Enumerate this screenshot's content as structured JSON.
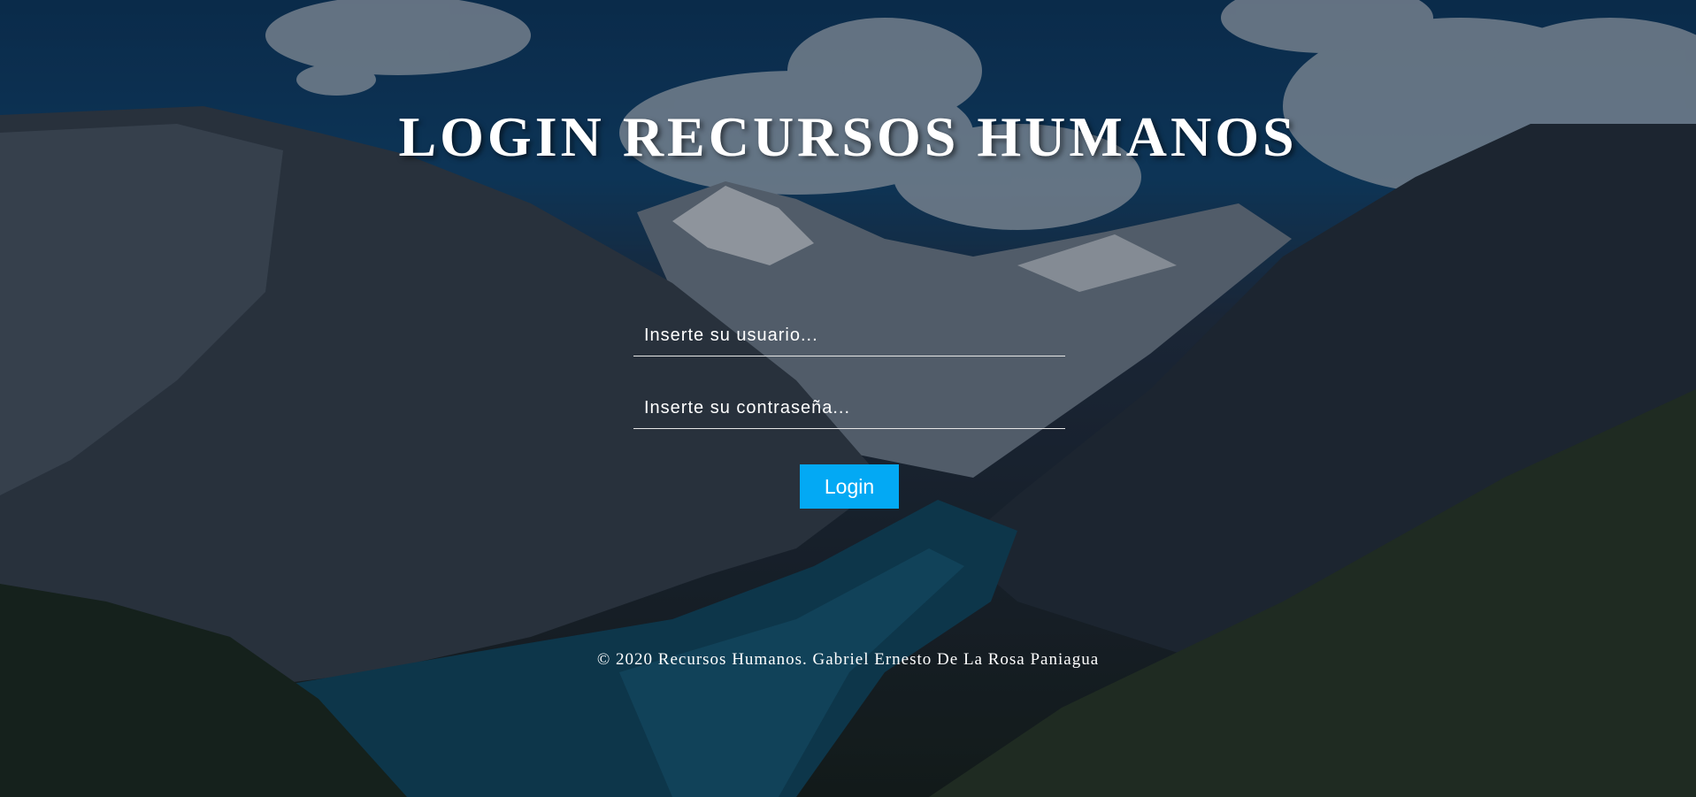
{
  "page": {
    "title": "LOGIN RECURSOS HUMANOS"
  },
  "form": {
    "username_placeholder": "Inserte su usuario...",
    "username_value": "",
    "password_placeholder": "Inserte su contraseña...",
    "password_value": "",
    "login_label": "Login"
  },
  "footer": {
    "text": "© 2020 Recursos Humanos. Gabriel Ernesto De La Rosa Paniagua"
  },
  "colors": {
    "accent": "#03a9f4",
    "text": "#ffffff",
    "overlay": "rgba(10,18,30,0.38)"
  },
  "background": {
    "icon": "mountain-lake-landscape"
  }
}
